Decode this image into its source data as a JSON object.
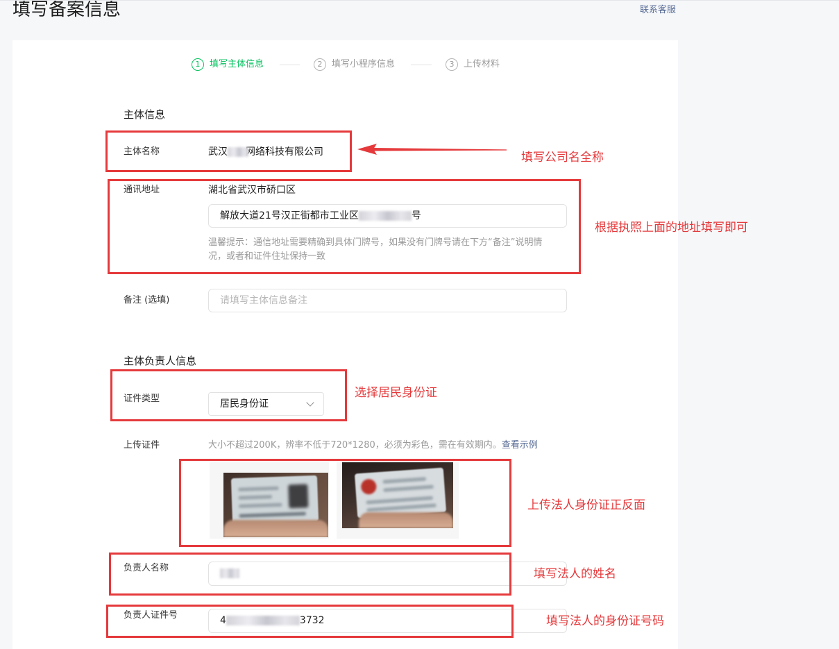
{
  "header": {
    "title": "填写备案信息",
    "contact_link": "联系客服"
  },
  "steps": [
    {
      "number": "1",
      "label": "填写主体信息",
      "active": true
    },
    {
      "number": "2",
      "label": "填写小程序信息",
      "active": false
    },
    {
      "number": "3",
      "label": "上传材料",
      "active": false
    }
  ],
  "subject": {
    "section_title": "主体信息",
    "company_name": {
      "label": "主体名称",
      "prefix": "武汉",
      "suffix": "网络科技有限公司"
    },
    "address": {
      "label": "通讯地址",
      "region": "湖北省武汉市硚口区",
      "detail_prefix": "解放大道21号汉正街都市工业区",
      "detail_suffix": "号",
      "hint": "温馨提示：通信地址需要精确到具体门牌号，如果没有门牌号请在下方“备注”说明情况，或者和证件住址保持一致"
    },
    "remark": {
      "label": "备注 (选填)",
      "placeholder": "请填写主体信息备注"
    }
  },
  "owner": {
    "section_title": "主体负责人信息",
    "id_type": {
      "label": "证件类型",
      "value": "居民身份证"
    },
    "upload": {
      "label": "上传证件",
      "hint": "大小不超过200K，辨率不低于720*1280，必须为彩色，需在有效期内。",
      "example_link": "查看示例"
    },
    "name": {
      "label": "负责人名称"
    },
    "id_number": {
      "label": "负责人证件号",
      "prefix": "4",
      "suffix": "3732"
    }
  },
  "annotations": {
    "company_name": "填写公司名全称",
    "address": "根据执照上面的地址填写即可",
    "id_type": "选择居民身份证",
    "id_upload": "上传法人身份证正反面",
    "legal_name": "填写法人的姓名",
    "id_number": "填写法人的身份证号码"
  },
  "icons": {
    "select_arrow": "chevron-down-icon",
    "annotation_pointer": "arrow-left-icon"
  },
  "colors": {
    "accent": "#07c160",
    "link": "#576b95",
    "annotation": "#e5393b",
    "background": "#f6f7f9"
  }
}
